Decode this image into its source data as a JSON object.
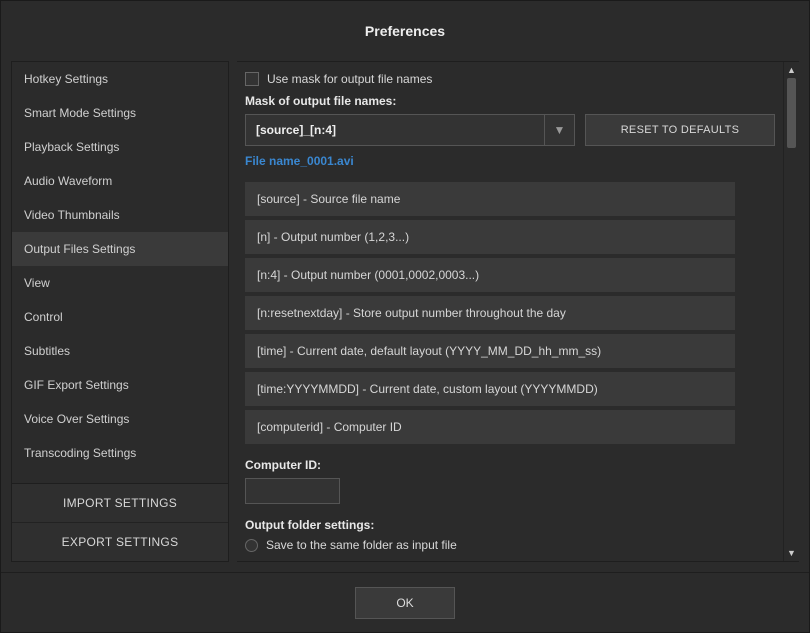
{
  "title": "Preferences",
  "sidebar": {
    "items": [
      {
        "label": "Hotkey Settings"
      },
      {
        "label": "Smart Mode Settings"
      },
      {
        "label": "Playback Settings"
      },
      {
        "label": "Audio Waveform"
      },
      {
        "label": "Video Thumbnails"
      },
      {
        "label": "Output Files Settings"
      },
      {
        "label": "View"
      },
      {
        "label": "Control"
      },
      {
        "label": "Subtitles"
      },
      {
        "label": "GIF Export Settings"
      },
      {
        "label": "Voice Over Settings"
      },
      {
        "label": "Transcoding Settings"
      }
    ],
    "active_index": 5,
    "import_label": "IMPORT SETTINGS",
    "export_label": "EXPORT SETTINGS"
  },
  "main": {
    "use_mask_label": "Use mask for output file names",
    "mask_heading": "Mask of output file names:",
    "mask_value": "[source]_[n:4]",
    "reset_label": "RESET TO DEFAULTS",
    "preview": "File name_0001.avi",
    "tokens": [
      "[source] - Source file name",
      "[n] - Output number (1,2,3...)",
      "[n:4] - Output number (0001,0002,0003...)",
      "[n:resetnextday] - Store output number throughout the day",
      "[time] - Current date, default layout (YYYY_MM_DD_hh_mm_ss)",
      "[time:YYYYMMDD] - Current date, custom layout (YYYYMMDD)",
      "[computerid] - Computer ID"
    ],
    "computer_id_label": "Computer ID:",
    "computer_id_value": "",
    "output_folder_heading": "Output folder settings:",
    "radio_same_folder": "Save to the same folder as input file"
  },
  "footer": {
    "ok_label": "OK"
  }
}
